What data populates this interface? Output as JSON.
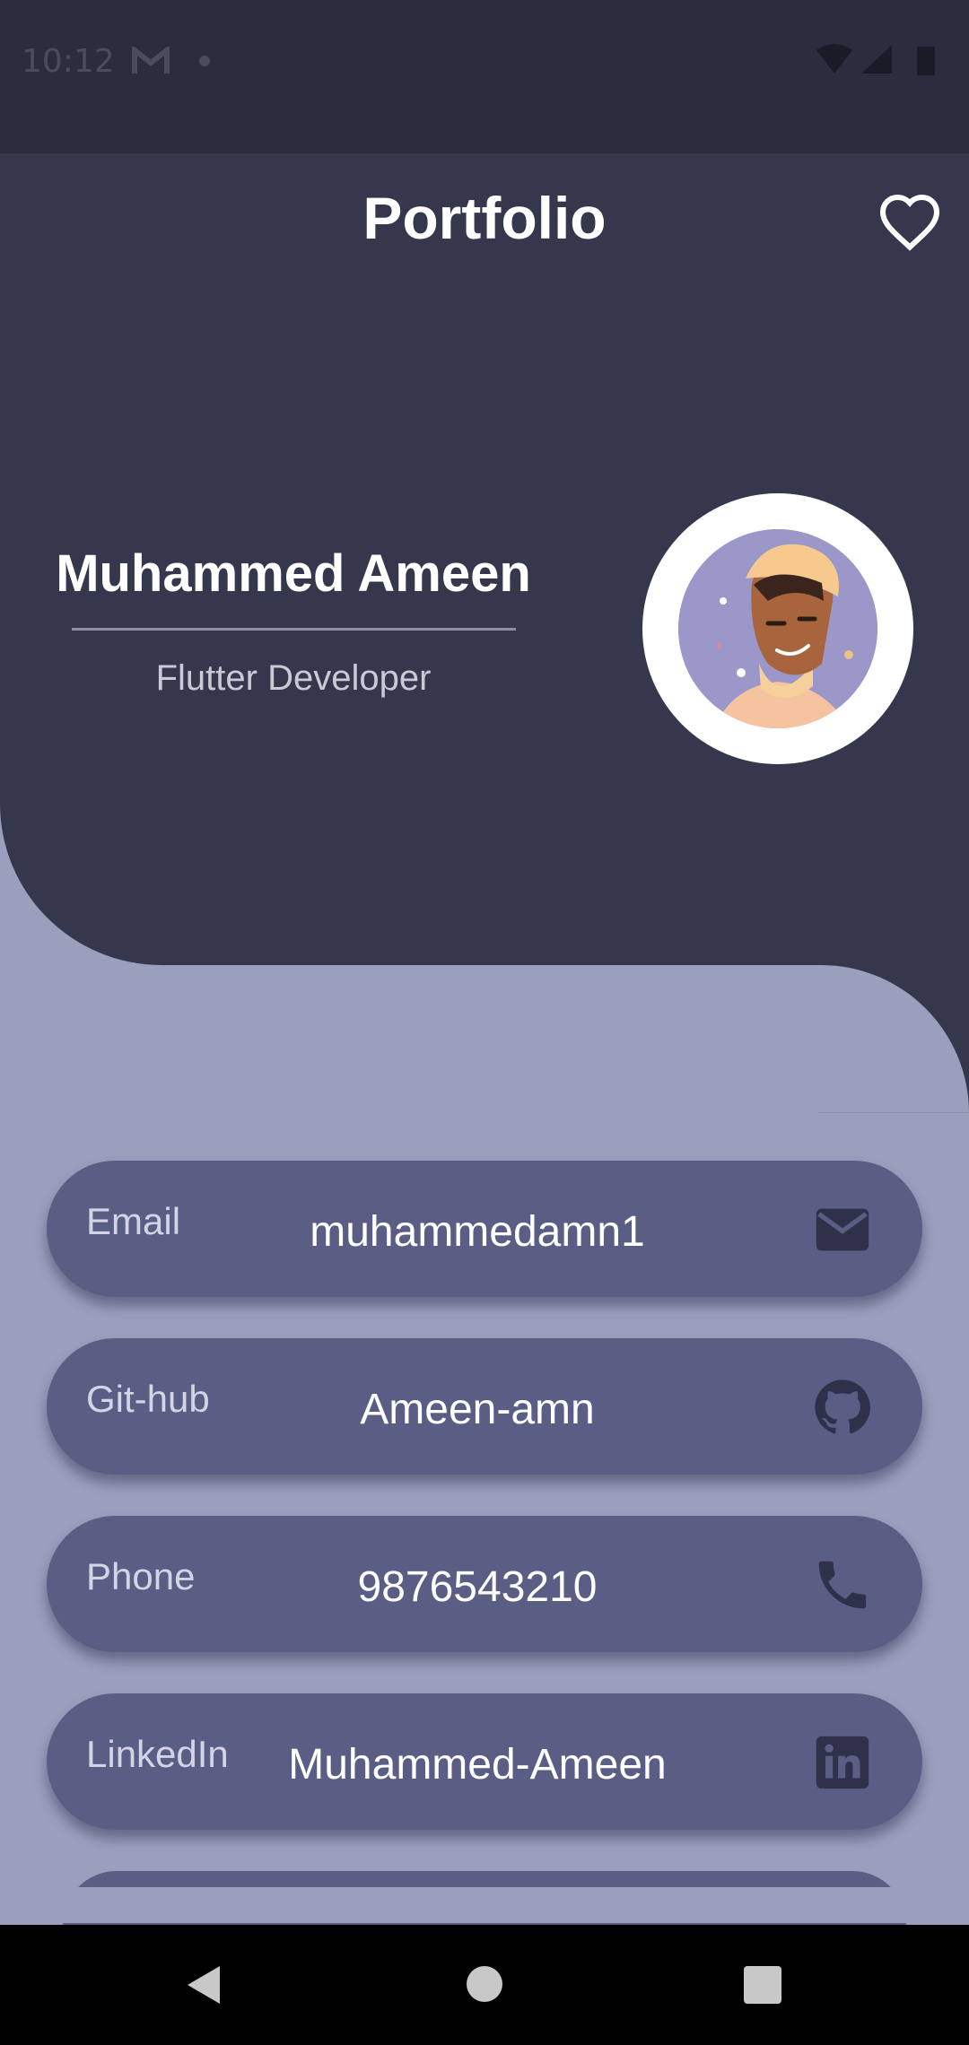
{
  "status_bar": {
    "time": "10:12"
  },
  "header": {
    "title": "Portfolio"
  },
  "profile": {
    "name": "Muhammed Ameen",
    "role": "Flutter Developer"
  },
  "contacts": [
    {
      "label": "Email",
      "value": "muhammedamn1",
      "icon": "mail-icon"
    },
    {
      "label": "Git-hub",
      "value": "Ameen-amn",
      "icon": "github-icon"
    },
    {
      "label": "Phone",
      "value": "9876543210",
      "icon": "phone-icon"
    },
    {
      "label": "LinkedIn",
      "value": "Muhammed-Ameen",
      "icon": "linkedin-icon"
    }
  ],
  "colors": {
    "header_bg": "#35374c",
    "page_bg": "#9a9fbd",
    "card_bg": "#5a5e85"
  }
}
